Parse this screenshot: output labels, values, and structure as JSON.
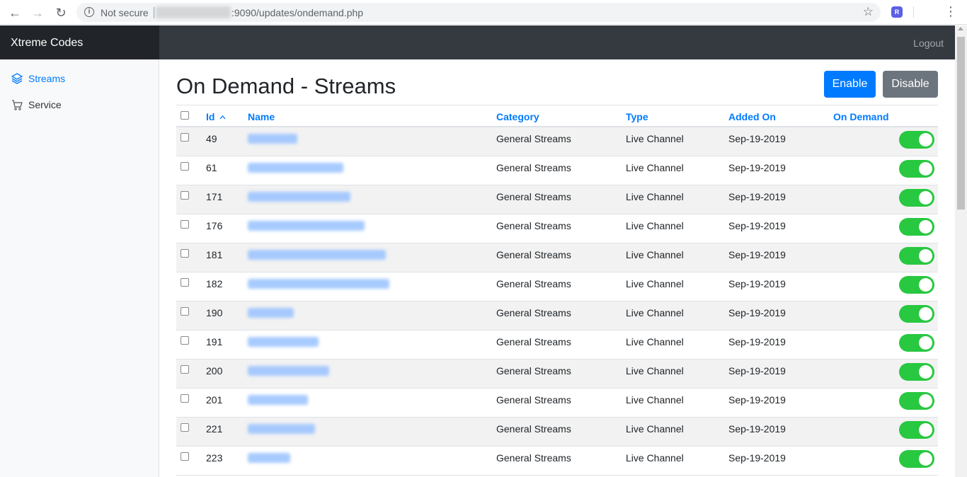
{
  "browser": {
    "security_label": "Not secure",
    "url_visible": ":9090/updates/ondemand.php"
  },
  "app": {
    "brand": "Xtreme Codes",
    "logout_label": "Logout"
  },
  "sidebar": {
    "items": [
      {
        "label": "Streams",
        "icon": "layers-icon",
        "active": true
      },
      {
        "label": "Service",
        "icon": "cart-icon",
        "active": false
      }
    ]
  },
  "main": {
    "title": "On Demand - Streams",
    "enable_label": "Enable",
    "disable_label": "Disable"
  },
  "table": {
    "columns": {
      "id": "Id",
      "name": "Name",
      "category": "Category",
      "type": "Type",
      "added_on": "Added On",
      "on_demand": "On Demand"
    },
    "sort_indicator": "^",
    "rows": [
      {
        "id": "49",
        "category": "General Streams",
        "type": "Live Channel",
        "added_on": "Sep-19-2019",
        "on_demand": true
      },
      {
        "id": "61",
        "category": "General Streams",
        "type": "Live Channel",
        "added_on": "Sep-19-2019",
        "on_demand": true
      },
      {
        "id": "171",
        "category": "General Streams",
        "type": "Live Channel",
        "added_on": "Sep-19-2019",
        "on_demand": true
      },
      {
        "id": "176",
        "category": "General Streams",
        "type": "Live Channel",
        "added_on": "Sep-19-2019",
        "on_demand": true
      },
      {
        "id": "181",
        "category": "General Streams",
        "type": "Live Channel",
        "added_on": "Sep-19-2019",
        "on_demand": true
      },
      {
        "id": "182",
        "category": "General Streams",
        "type": "Live Channel",
        "added_on": "Sep-19-2019",
        "on_demand": true
      },
      {
        "id": "190",
        "category": "General Streams",
        "type": "Live Channel",
        "added_on": "Sep-19-2019",
        "on_demand": true
      },
      {
        "id": "191",
        "category": "General Streams",
        "type": "Live Channel",
        "added_on": "Sep-19-2019",
        "on_demand": true
      },
      {
        "id": "200",
        "category": "General Streams",
        "type": "Live Channel",
        "added_on": "Sep-19-2019",
        "on_demand": true
      },
      {
        "id": "201",
        "category": "General Streams",
        "type": "Live Channel",
        "added_on": "Sep-19-2019",
        "on_demand": true
      },
      {
        "id": "221",
        "category": "General Streams",
        "type": "Live Channel",
        "added_on": "Sep-19-2019",
        "on_demand": true
      },
      {
        "id": "223",
        "category": "General Streams",
        "type": "Live Channel",
        "added_on": "Sep-19-2019",
        "on_demand": true
      }
    ]
  },
  "colors": {
    "accent": "#007bff",
    "toggle_on": "#28c840",
    "navbar_dark": "#343a40",
    "brand_dark": "#212529",
    "disable_btn": "#6c757d"
  }
}
